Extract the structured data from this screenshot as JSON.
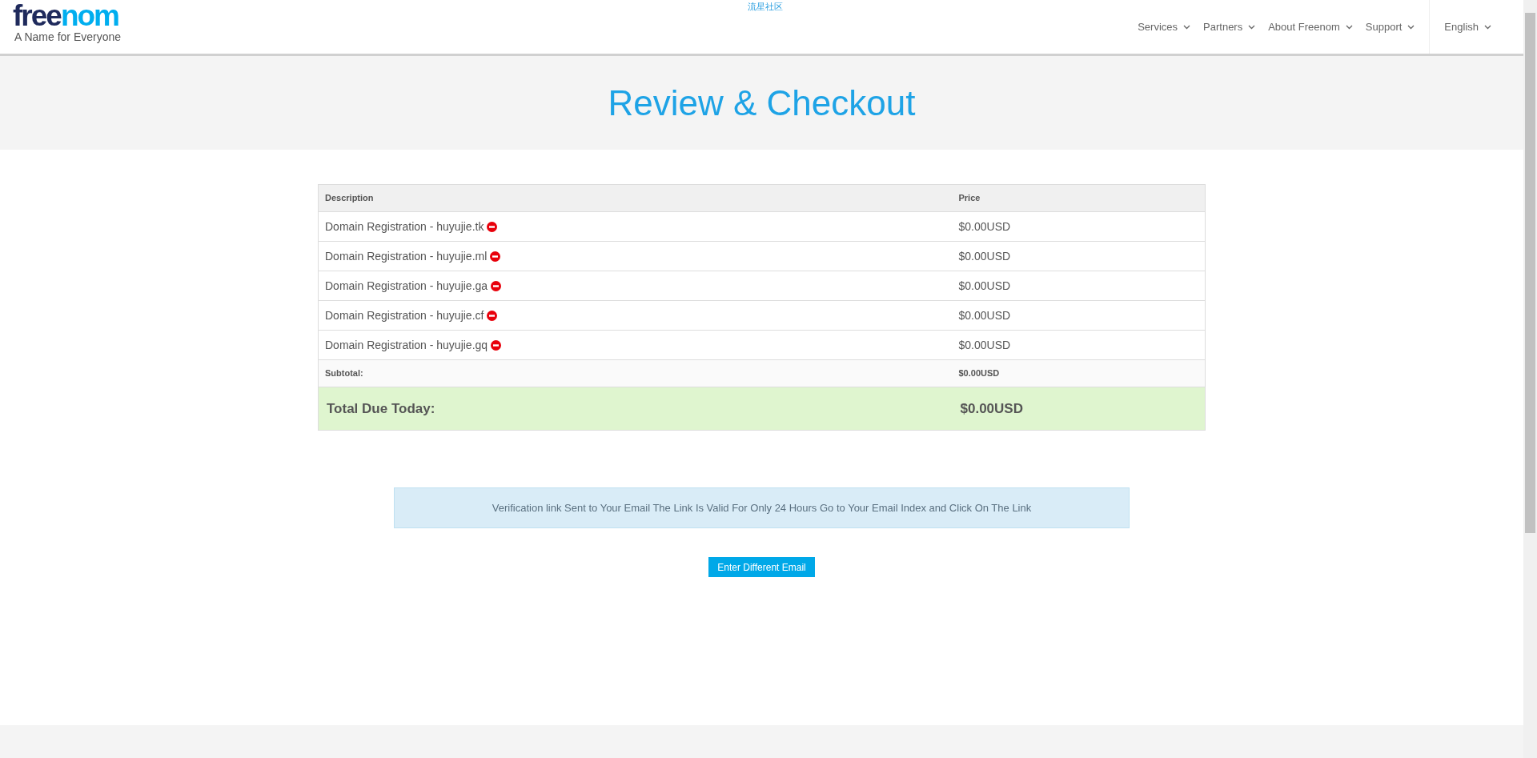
{
  "top_link": "流星社区",
  "logo": {
    "dark_part": "free",
    "light_part": "nom",
    "tagline": "A Name for Everyone"
  },
  "nav": [
    {
      "label": "Services"
    },
    {
      "label": "Partners"
    },
    {
      "label": "About Freenom"
    },
    {
      "label": "Support"
    }
  ],
  "language": {
    "label": "English"
  },
  "page_title": "Review & Checkout",
  "table": {
    "columns": [
      "Description",
      "Price"
    ],
    "rows": [
      {
        "description": "Domain Registration - huyujie.tk",
        "price": "$0.00USD"
      },
      {
        "description": "Domain Registration - huyujie.ml",
        "price": "$0.00USD"
      },
      {
        "description": "Domain Registration - huyujie.ga",
        "price": "$0.00USD"
      },
      {
        "description": "Domain Registration - huyujie.cf",
        "price": "$0.00USD"
      },
      {
        "description": "Domain Registration - huyujie.gq",
        "price": "$0.00USD"
      }
    ],
    "subtotal": {
      "label": "Subtotal:",
      "value": "$0.00USD"
    },
    "total": {
      "label": "Total Due Today:",
      "value": "$0.00USD"
    }
  },
  "alert": "Verification link Sent to Your Email The Link Is Valid For Only 24 Hours Go to Your Email Index and Click On The Link",
  "button": "Enter Different Email"
}
